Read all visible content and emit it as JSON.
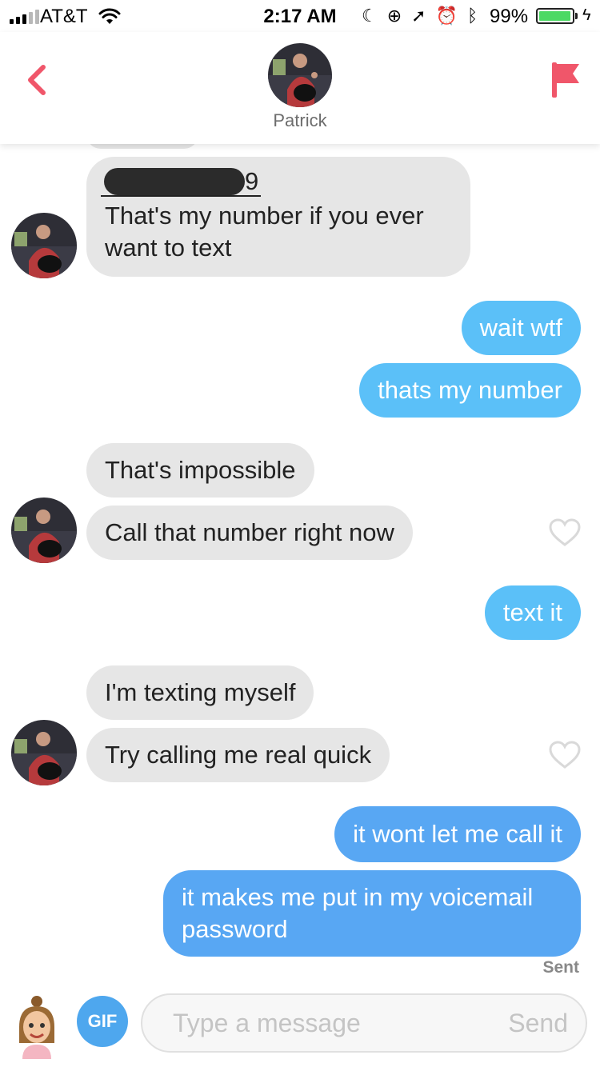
{
  "status_bar": {
    "carrier": "AT&T",
    "time": "2:17 AM",
    "battery_percent": "99%",
    "battery_level": 0.99,
    "icons": [
      "moon-icon",
      "rotation-lock-icon",
      "location-arrow-icon",
      "alarm-icon",
      "bluetooth-icon",
      "charging-bolt-icon"
    ]
  },
  "header": {
    "contact_name": "Patrick",
    "back_icon": "chevron-left-icon",
    "report_icon": "flag-icon",
    "accent_color": "#f0566a"
  },
  "messages": [
    {
      "dir": "in",
      "redacted_prefix": true,
      "number_tail": "9",
      "text": "That's my number if you ever want to text"
    },
    {
      "dir": "out",
      "text": "wait wtf"
    },
    {
      "dir": "out",
      "text": "thats my number"
    },
    {
      "dir": "in",
      "text": "That's impossible"
    },
    {
      "dir": "in",
      "text": "Call that number right now",
      "like_icon": "heart-outline-icon"
    },
    {
      "dir": "out",
      "text": "text it"
    },
    {
      "dir": "in",
      "text": "I'm texting myself"
    },
    {
      "dir": "in",
      "text": "Try calling me real quick",
      "like_icon": "heart-outline-icon"
    },
    {
      "dir": "out",
      "text": "it wont let me call it"
    },
    {
      "dir": "out",
      "text": "it makes me put in my voicemail password"
    }
  ],
  "sent_status": "Sent",
  "input_bar": {
    "gif_label": "GIF",
    "placeholder": "Type a message",
    "value": "",
    "send_label": "Send"
  },
  "colors": {
    "outgoing_bubble": "#5bc0f8",
    "incoming_bubble": "#e6e6e6",
    "gif_button": "#4ea7ee"
  }
}
